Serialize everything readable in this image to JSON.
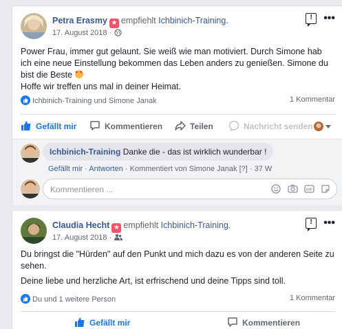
{
  "posts": [
    {
      "author": "Petra Erasmy",
      "recommends_prefix": "empfiehlt",
      "recommends_page": "Ichbinich-Training.",
      "date": "17. August 2018",
      "text_lines": [
        "Power Frau, immer gut gelaunt. Sie weiß wie man motiviert. Durch Simone hab ich eine neue Einstellung bekommen das Leben anders zu genießen. Simone du bist die Beste",
        "Hoffe wir treffen uns mal in deiner Heimat."
      ],
      "reactions_text": "Ichbinich-Training und Simone Janak",
      "comment_count": "1 Kommentar",
      "actions": {
        "like": "Gefällt mir",
        "comment": "Kommentieren",
        "share": "Teilen",
        "message": "Nachricht senden"
      },
      "comment": {
        "author": "Ichbinich-Training",
        "text": "Danke die - das ist wirklich wunderbar !",
        "like": "Gefällt mir",
        "reply": "Antworten",
        "meta": "Kommentiert von Simone Janak [?]",
        "time": "37 W"
      },
      "comment_input_placeholder": "Kommentieren ..."
    },
    {
      "author": "Claudia Hecht",
      "recommends_prefix": "empfiehlt",
      "recommends_page": "Ichbinich-Training.",
      "date": "17. August 2018",
      "text_lines": [
        "Du bringst die \"Hürden\" auf den Punkt und mich dazu es von der anderen Seite zu sehen.",
        "Deine liebe und herzliche Art, ist erfrischend und deine Tipps sind toll."
      ],
      "reactions_text": "Du und 1 weitere Person",
      "comment_count": "1 Kommentar",
      "actions": {
        "like": "Gefällt mir",
        "comment": "Kommentieren"
      }
    }
  ],
  "colors": {
    "link": "#385898",
    "like_blue": "#1877f2",
    "badge": "#f35369"
  },
  "icons": [
    "report-icon",
    "more-icon",
    "globe-icon",
    "friends-icon",
    "like-icon",
    "comment-icon",
    "share-icon",
    "messenger-icon",
    "emoji-icon",
    "camera-icon",
    "gif-icon",
    "sticker-icon",
    "heart-eyes-emoji"
  ]
}
